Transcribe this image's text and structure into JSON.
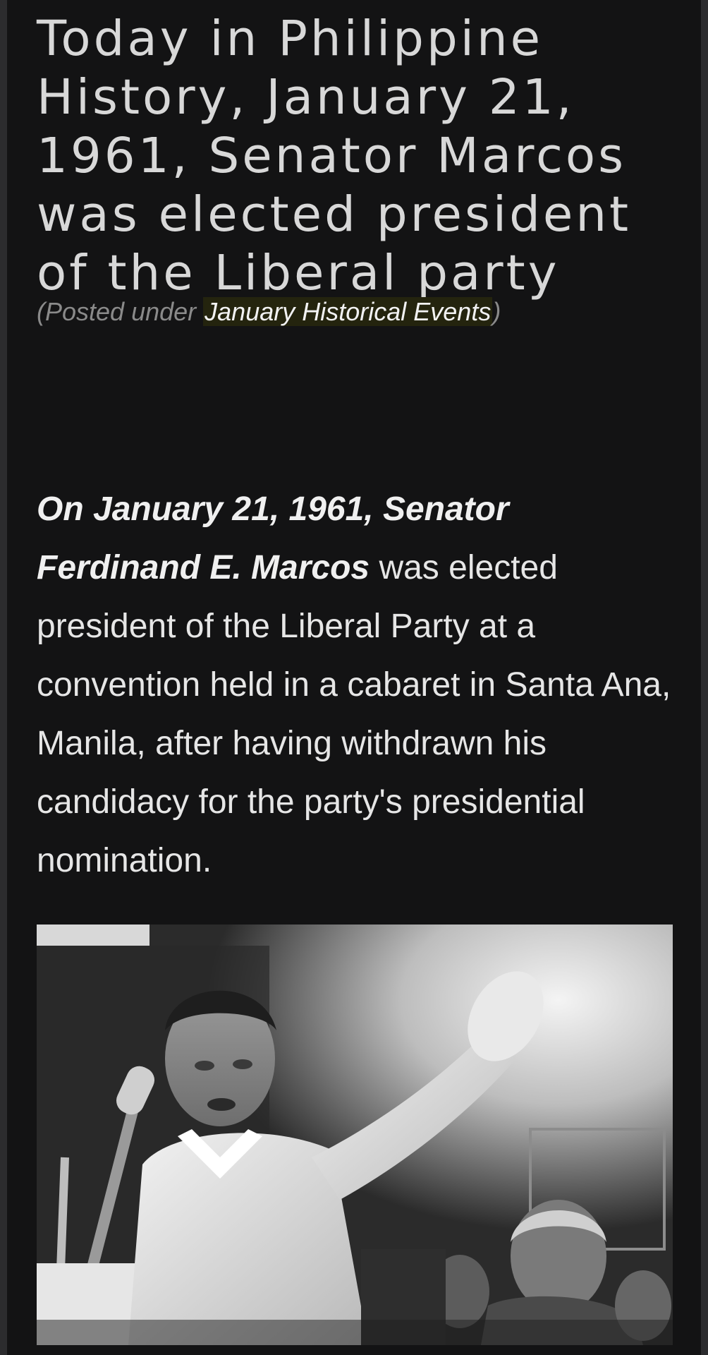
{
  "post": {
    "title": "Today in Philippine History, January 21, 1961, Senator Marcos was elected president of the Liberal party",
    "posted_under_prefix": "(Posted under ",
    "category": "January Historical Events",
    "posted_under_suffix": ")"
  },
  "article": {
    "lead": "On January 21, 1961, Senator Ferdinand E. Marcos",
    "body": " was elected president of the Liberal Party at a convention held in a cabaret in Santa Ana, Manila, after having withdrawn his candidacy for the party's presidential nomination."
  },
  "photo": {
    "description_icon": "black-and-white-photo"
  }
}
